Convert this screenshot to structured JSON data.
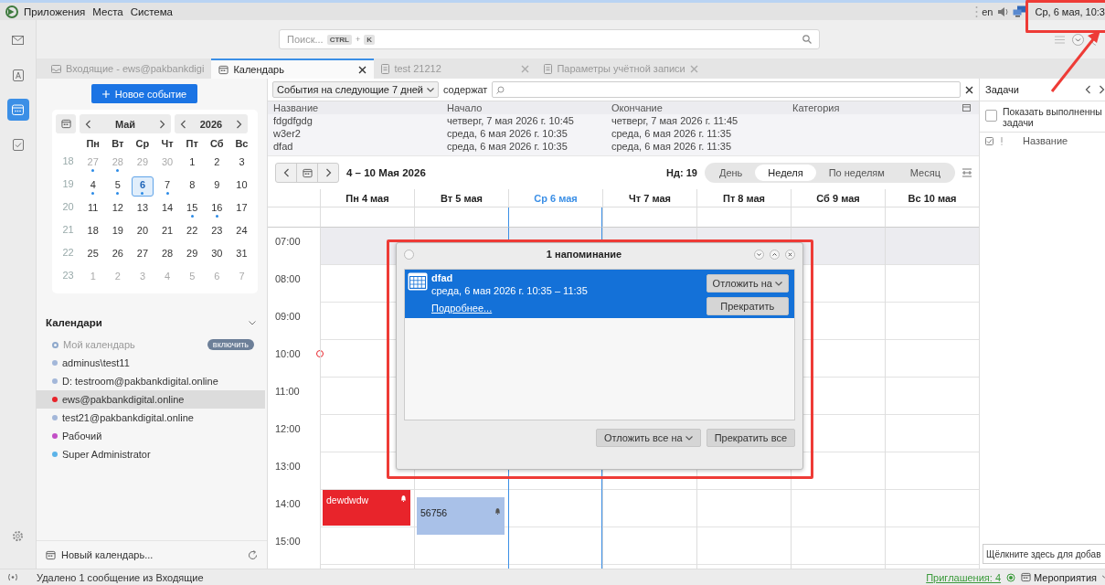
{
  "panel": {
    "menus": [
      "Приложения",
      "Места",
      "Система"
    ],
    "keyboard_layout": "en",
    "clock": "Ср, 6 мая, 10:3"
  },
  "toolbar": {
    "search": {
      "placeholder": "Поиск...",
      "shortcut_keys": [
        "CTRL",
        "K"
      ],
      "shortcut_joiner": "+"
    }
  },
  "tabs": [
    {
      "label": "Входящие - ews@pakbankdigi",
      "selected": false,
      "closable": false
    },
    {
      "label": "Календарь",
      "selected": true,
      "closable": true
    },
    {
      "label": "test 21212",
      "selected": false,
      "closable": true
    },
    {
      "label": "Параметры учётной записи",
      "selected": false,
      "closable": true
    }
  ],
  "sidebar": {
    "new_event": "Новое событие",
    "mini_calendar": {
      "month": "Май",
      "year": "2026",
      "weekdays": [
        "Пн",
        "Вт",
        "Ср",
        "Чт",
        "Пт",
        "Сб",
        "Вс"
      ],
      "weeks": [
        {
          "number": "18",
          "days": [
            {
              "day": "27",
              "in_month": false,
              "has_events": true,
              "selected": false
            },
            {
              "day": "28",
              "in_month": false,
              "has_events": true,
              "selected": false
            },
            {
              "day": "29",
              "in_month": false,
              "has_events": false,
              "selected": false
            },
            {
              "day": "30",
              "in_month": false,
              "has_events": false,
              "selected": false
            },
            {
              "day": "1",
              "in_month": true,
              "has_events": false,
              "selected": false
            },
            {
              "day": "2",
              "in_month": true,
              "has_events": false,
              "selected": false
            },
            {
              "day": "3",
              "in_month": true,
              "has_events": false,
              "selected": false
            }
          ]
        },
        {
          "number": "19",
          "days": [
            {
              "day": "4",
              "in_month": true,
              "has_events": true,
              "selected": false
            },
            {
              "day": "5",
              "in_month": true,
              "has_events": true,
              "selected": false
            },
            {
              "day": "6",
              "in_month": true,
              "has_events": true,
              "selected": true
            },
            {
              "day": "7",
              "in_month": true,
              "has_events": true,
              "selected": false
            },
            {
              "day": "8",
              "in_month": true,
              "has_events": false,
              "selected": false
            },
            {
              "day": "9",
              "in_month": true,
              "has_events": false,
              "selected": false
            },
            {
              "day": "10",
              "in_month": true,
              "has_events": false,
              "selected": false
            }
          ]
        },
        {
          "number": "20",
          "days": [
            {
              "day": "11",
              "in_month": true,
              "has_events": false,
              "selected": false
            },
            {
              "day": "12",
              "in_month": true,
              "has_events": false,
              "selected": false
            },
            {
              "day": "13",
              "in_month": true,
              "has_events": false,
              "selected": false
            },
            {
              "day": "14",
              "in_month": true,
              "has_events": false,
              "selected": false
            },
            {
              "day": "15",
              "in_month": true,
              "has_events": true,
              "selected": false
            },
            {
              "day": "16",
              "in_month": true,
              "has_events": true,
              "selected": false
            },
            {
              "day": "17",
              "in_month": true,
              "has_events": false,
              "selected": false
            }
          ]
        },
        {
          "number": "21",
          "days": [
            {
              "day": "18",
              "in_month": true,
              "has_events": false,
              "selected": false
            },
            {
              "day": "19",
              "in_month": true,
              "has_events": false,
              "selected": false
            },
            {
              "day": "20",
              "in_month": true,
              "has_events": false,
              "selected": false
            },
            {
              "day": "21",
              "in_month": true,
              "has_events": false,
              "selected": false
            },
            {
              "day": "22",
              "in_month": true,
              "has_events": false,
              "selected": false
            },
            {
              "day": "23",
              "in_month": true,
              "has_events": false,
              "selected": false
            },
            {
              "day": "24",
              "in_month": true,
              "has_events": false,
              "selected": false
            }
          ]
        },
        {
          "number": "22",
          "days": [
            {
              "day": "25",
              "in_month": true,
              "has_events": false,
              "selected": false
            },
            {
              "day": "26",
              "in_month": true,
              "has_events": false,
              "selected": false
            },
            {
              "day": "27",
              "in_month": true,
              "has_events": false,
              "selected": false
            },
            {
              "day": "28",
              "in_month": true,
              "has_events": false,
              "selected": false
            },
            {
              "day": "29",
              "in_month": true,
              "has_events": false,
              "selected": false
            },
            {
              "day": "30",
              "in_month": true,
              "has_events": false,
              "selected": false
            },
            {
              "day": "31",
              "in_month": true,
              "has_events": false,
              "selected": false
            }
          ]
        },
        {
          "number": "23",
          "days": [
            {
              "day": "1",
              "in_month": false,
              "has_events": false,
              "selected": false
            },
            {
              "day": "2",
              "in_month": false,
              "has_events": false,
              "selected": false
            },
            {
              "day": "3",
              "in_month": false,
              "has_events": false,
              "selected": false
            },
            {
              "day": "4",
              "in_month": false,
              "has_events": false,
              "selected": false
            },
            {
              "day": "5",
              "in_month": false,
              "has_events": false,
              "selected": false
            },
            {
              "day": "6",
              "in_month": false,
              "has_events": false,
              "selected": false
            },
            {
              "day": "7",
              "in_month": false,
              "has_events": false,
              "selected": false
            }
          ]
        }
      ]
    },
    "calendars_title": "Календари",
    "calendars": [
      {
        "name": "Мой календарь",
        "color": "#8fa9cc",
        "enabled": false,
        "selected": false,
        "action": "включить"
      },
      {
        "name": "adminus\\test11",
        "color": "#a3b7d9",
        "enabled": true,
        "selected": false
      },
      {
        "name": "D: testroom@pakbankdigital.online",
        "color": "#a3b7d9",
        "enabled": true,
        "selected": false
      },
      {
        "name": "ews@pakbankdigital.online",
        "color": "#e8242b",
        "enabled": true,
        "selected": true
      },
      {
        "name": "test21@pakbankdigital.online",
        "color": "#a3b7d9",
        "enabled": true,
        "selected": false
      },
      {
        "name": "Рабочий",
        "color": "#c24fc6",
        "enabled": true,
        "selected": false
      },
      {
        "name": "Super Administrator",
        "color": "#5cb3e8",
        "enabled": true,
        "selected": false
      }
    ],
    "new_calendar": "Новый календарь..."
  },
  "filter": {
    "range": "События на следующие 7 дней",
    "contains_label": "содержат"
  },
  "event_list": {
    "columns": [
      "Название",
      "Начало",
      "Окончание",
      "Категория"
    ],
    "rows": [
      {
        "title": "fdgdfgdg",
        "start": "четверг, 7 мая 2026 г. 10:45",
        "end": "четверг, 7 мая 2026 г. 11:45"
      },
      {
        "title": "w3er2",
        "start": "среда, 6 мая 2026 г. 10:35",
        "end": "среда, 6 мая 2026 г. 11:35"
      },
      {
        "title": "dfad",
        "start": "среда, 6 мая 2026 г. 10:35",
        "end": "среда, 6 мая 2026 г. 11:35"
      }
    ]
  },
  "navigation": {
    "range_title": "4 – 10 Мая 2026",
    "week_label": "Нд: 19",
    "views": [
      {
        "label": "День",
        "selected": false
      },
      {
        "label": "Неделя",
        "selected": true
      },
      {
        "label": "По неделям",
        "selected": false
      },
      {
        "label": "Месяц",
        "selected": false
      }
    ]
  },
  "week": {
    "hours": [
      {
        "label": "07:00",
        "off_hours": true
      },
      {
        "label": "08:00",
        "off_hours": false
      },
      {
        "label": "09:00",
        "off_hours": false
      },
      {
        "label": "10:00",
        "off_hours": false
      },
      {
        "label": "11:00",
        "off_hours": false
      },
      {
        "label": "12:00",
        "off_hours": false
      },
      {
        "label": "13:00",
        "off_hours": false
      },
      {
        "label": "14:00",
        "off_hours": false
      },
      {
        "label": "15:00",
        "off_hours": false
      }
    ],
    "days": [
      {
        "label": "Пн 4 мая",
        "today": false,
        "events": [
          {
            "title": "dewdwdw",
            "color": "#e8242b",
            "alarm": true
          }
        ]
      },
      {
        "label": "Вт 5 мая",
        "today": false,
        "events": [
          {
            "title": "56756",
            "color": "#a9c1e8",
            "alarm": true
          }
        ]
      },
      {
        "label": "Ср 6 мая",
        "today": true
      },
      {
        "label": "Чт 7 мая",
        "today": false
      },
      {
        "label": "Пт 8 мая",
        "today": false
      },
      {
        "label": "Сб 9 мая",
        "today": false
      },
      {
        "label": "Вс 10 мая",
        "today": false
      }
    ]
  },
  "reminder_dialog": {
    "title": "1 напоминание",
    "reminders": [
      {
        "title": "dfad",
        "when": "среда, 6 мая 2026 г. 10:35 – 11:35",
        "details_link": "Подробнее...",
        "snooze": "Отложить на",
        "dismiss": "Прекратить",
        "selected": true
      }
    ],
    "snooze_all": "Отложить все на",
    "dismiss_all": "Прекратить все"
  },
  "tasks": {
    "title": "Задачи",
    "show_completed": {
      "label": "Показать выполненны задачи",
      "checked": false
    },
    "column": "Название",
    "quick_add_placeholder": "Щёлкните здесь для добав"
  },
  "status_bar": {
    "message": "Удалено 1 сообщение из Входящие",
    "invitations": "Приглашения: 4",
    "events_menu": "Мероприятия"
  }
}
